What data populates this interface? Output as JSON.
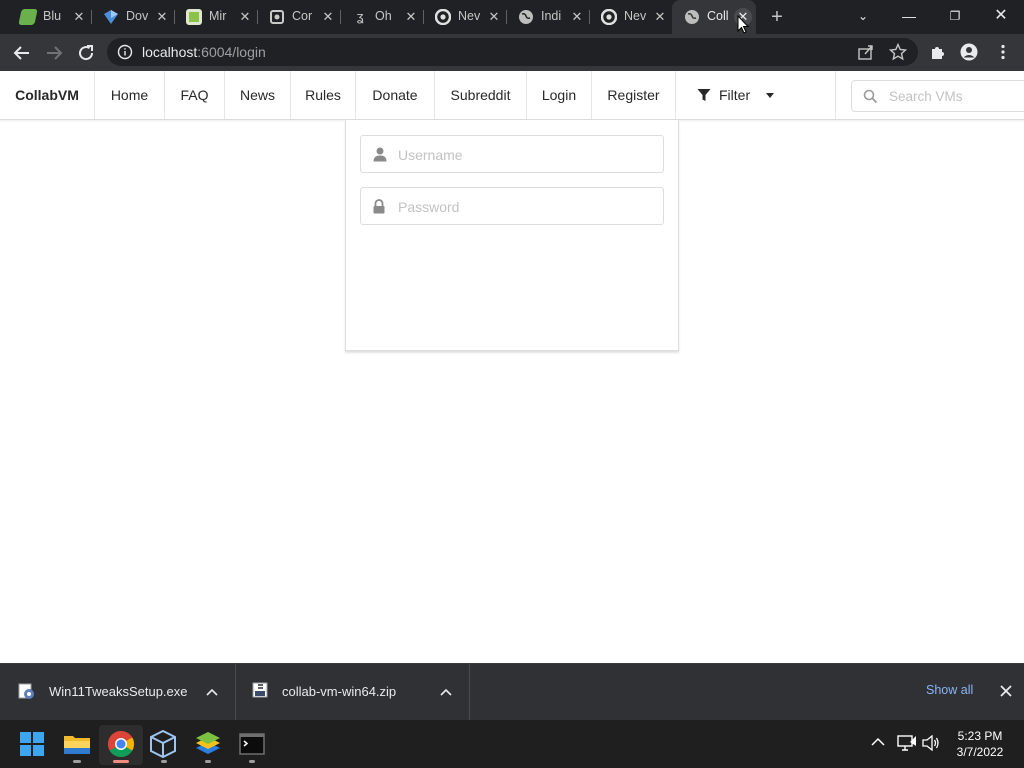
{
  "browser": {
    "tabs": [
      {
        "title": "Blu",
        "color": "#6ab04c"
      },
      {
        "title": "Dov",
        "color": "#2f80ed"
      },
      {
        "title": "Mir",
        "color": "#8bc34a"
      },
      {
        "title": "Cor",
        "color": "#bdbdbd"
      },
      {
        "title": "Oh",
        "color": "#bdbdbd"
      },
      {
        "title": "Nev",
        "color": "#e0e0e0"
      },
      {
        "title": "Indi",
        "color": "#bdbdbd"
      },
      {
        "title": "Nev",
        "color": "#e0e0e0"
      },
      {
        "title": "Coll",
        "color": "#bdbdbd",
        "active": true
      }
    ],
    "url_host": "localhost",
    "url_rest": ":6004/login"
  },
  "site": {
    "brand": "CollabVM",
    "nav": [
      "Home",
      "FAQ",
      "News",
      "Rules",
      "Donate",
      "Subreddit",
      "Login",
      "Register"
    ],
    "filter_label": "Filter",
    "search_placeholder": "Search VMs"
  },
  "login": {
    "username_placeholder": "Username",
    "password_placeholder": "Password"
  },
  "downloads": {
    "items": [
      {
        "name": "Win11TweaksSetup.exe"
      },
      {
        "name": "collab-vm-win64.zip"
      }
    ],
    "show_all": "Show all"
  },
  "taskbar": {
    "apps": [
      "windows-start",
      "file-explorer",
      "chrome",
      "virtualbox",
      "bluestacks",
      "terminal"
    ],
    "time": "5:23 PM",
    "date": "3/7/2022"
  },
  "colors": {
    "link_blue": "#8ab4f8",
    "chrome_dark": "#202124",
    "chrome_toolbar": "#35363a"
  }
}
